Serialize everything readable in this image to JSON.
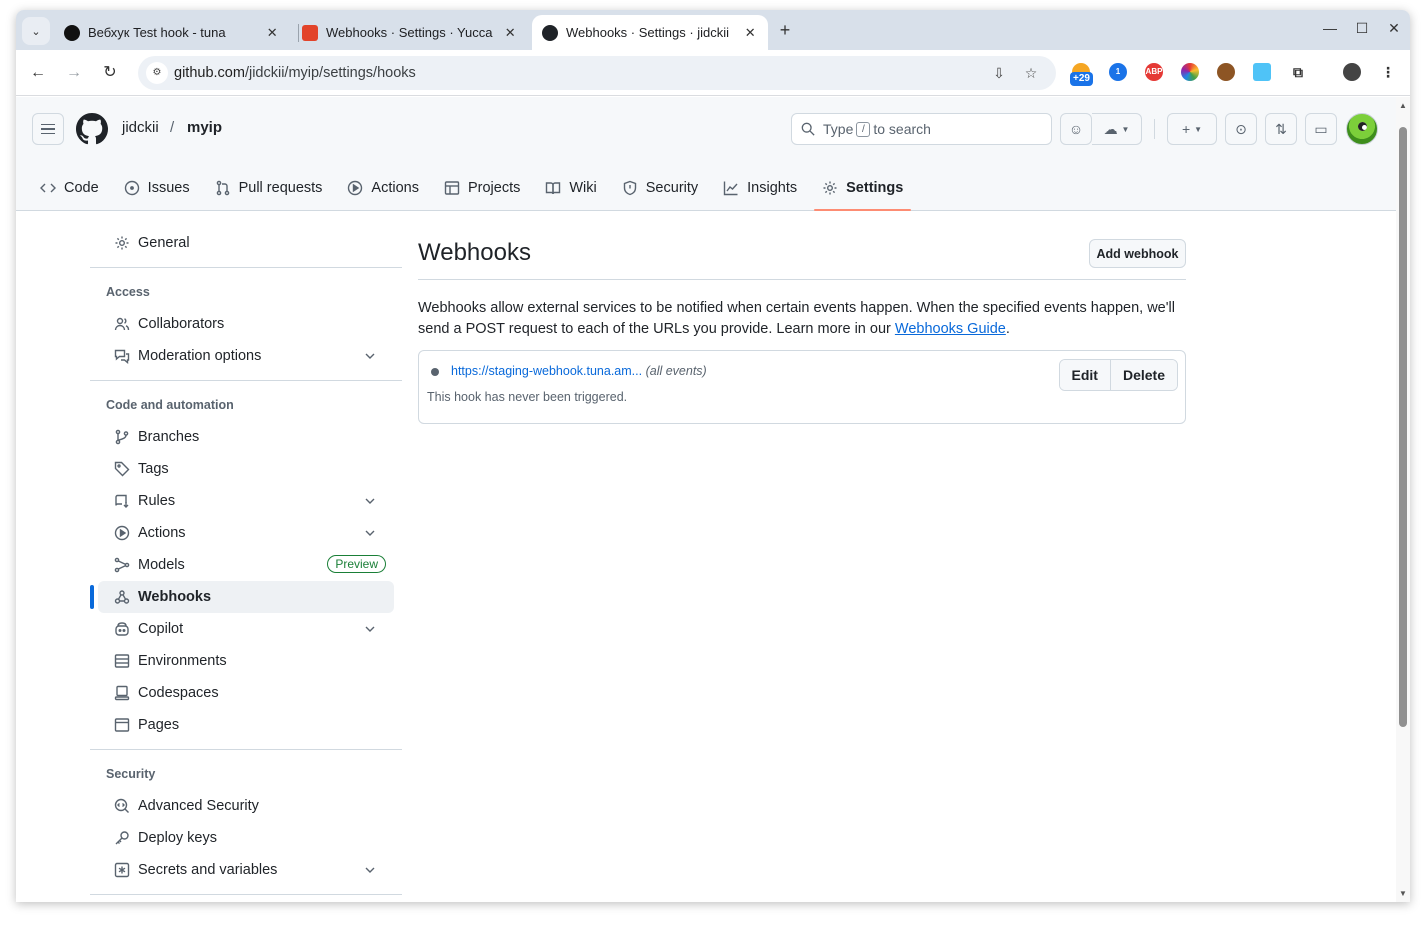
{
  "browser": {
    "tabs": [
      {
        "title": "Вебхук Test hook - tuna",
        "icon": "tuna-icon",
        "active": false
      },
      {
        "title": "Webhooks · Settings · Yucca",
        "icon": "gitlab-icon",
        "active": false
      },
      {
        "title": "Webhooks · Settings · jidckii",
        "icon": "github-icon",
        "active": true
      }
    ],
    "url_host": "github.com",
    "url_path": "/jidckii/myip/settings/hooks",
    "extension_badge": "+29"
  },
  "header": {
    "owner": "jidckii",
    "separator": "/",
    "repo": "myip",
    "search_prefix": "Type",
    "search_key": "/",
    "search_suffix": "to search"
  },
  "repo_nav": [
    {
      "label": "Code",
      "icon": "code-icon"
    },
    {
      "label": "Issues",
      "icon": "issue-icon"
    },
    {
      "label": "Pull requests",
      "icon": "pull-request-icon"
    },
    {
      "label": "Actions",
      "icon": "play-icon"
    },
    {
      "label": "Projects",
      "icon": "table-icon"
    },
    {
      "label": "Wiki",
      "icon": "book-icon"
    },
    {
      "label": "Security",
      "icon": "shield-icon"
    },
    {
      "label": "Insights",
      "icon": "graph-icon"
    },
    {
      "label": "Settings",
      "icon": "gear-icon",
      "selected": true
    }
  ],
  "sidebar": {
    "general": "General",
    "access_group": "Access",
    "collaborators": "Collaborators",
    "moderation": "Moderation options",
    "code_group": "Code and automation",
    "branches": "Branches",
    "tags": "Tags",
    "rules": "Rules",
    "actions": "Actions",
    "models": "Models",
    "preview": "Preview",
    "webhooks": "Webhooks",
    "copilot": "Copilot",
    "environments": "Environments",
    "codespaces": "Codespaces",
    "pages": "Pages",
    "security_group": "Security",
    "advanced_security": "Advanced Security",
    "deploy_keys": "Deploy keys",
    "secrets": "Secrets and variables"
  },
  "main": {
    "title": "Webhooks",
    "add_button": "Add webhook",
    "description": "Webhooks allow external services to be notified when certain events happen. When the specified events happen, we'll send a POST request to each of the URLs you provide. Learn more in our ",
    "guide_link": "Webhooks Guide",
    "description_end": ".",
    "hook": {
      "url": "https://staging-webhook.tuna.am...",
      "events": "(all events)",
      "status": "This hook has never been triggered.",
      "edit": "Edit",
      "delete": "Delete"
    }
  },
  "colors": {
    "accent": "#0969da",
    "tab_underline": "#fd8c73",
    "preview_green": "#1a7f37"
  }
}
